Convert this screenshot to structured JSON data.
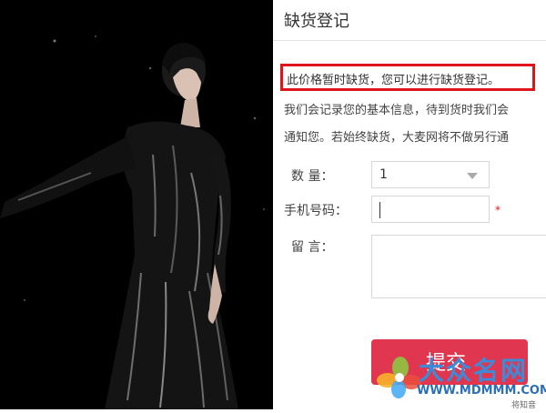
{
  "dialog": {
    "title": "缺货登记",
    "notice": "此价格暂时缺货，您可以进行缺货登记。",
    "description_line1": "我们会记录您的基本信息，待到货时我们会",
    "description_line2": "通知您。若始终缺货，大麦网将不做另行通"
  },
  "form": {
    "quantity_label": "数    量：",
    "quantity_value": "1",
    "phone_label": "手机号码：",
    "phone_value": "",
    "required_mark": "*",
    "message_label": "留    言：",
    "message_value": "",
    "submit_label": "提交"
  },
  "watermark": {
    "text": "大众名网",
    "url": "WWW.MDMMM.COM",
    "corner_text": "将知音"
  },
  "colors": {
    "notice_border": "#e0141b",
    "submit_bg": "#e0364f"
  }
}
